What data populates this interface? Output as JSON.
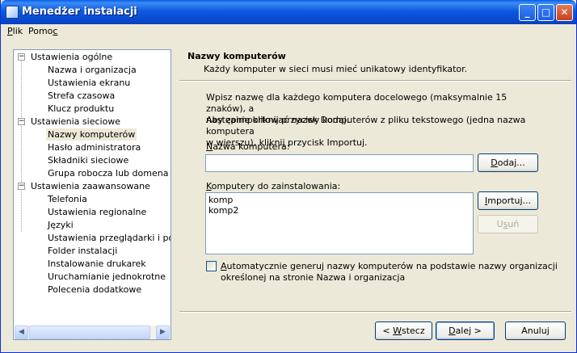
{
  "window": {
    "title": "Menedżer instalacji"
  },
  "menu": [
    {
      "label": "Plik",
      "key": "P",
      "rest": "lik"
    },
    {
      "label": "Pomoc",
      "pre": "Pomo",
      "key": "c"
    }
  ],
  "tree": {
    "groups": [
      {
        "label": "Ustawienia ogólne",
        "items": [
          "Nazwa i organizacja",
          "Ustawienia ekranu",
          "Strefa czasowa",
          "Klucz produktu"
        ]
      },
      {
        "label": "Ustawienia sieciowe",
        "items": [
          "Nazwy komputerów",
          "Hasło administratora",
          "Składniki sieciowe",
          "Grupa robocza lub domena"
        ]
      },
      {
        "label": "Ustawienia zaawansowane",
        "items": [
          "Telefonia",
          "Ustawienia regionalne",
          "Języki",
          "Ustawienia przeglądarki i powłok",
          "Folder instalacji",
          "Instalowanie drukarek",
          "Uruchamianie jednokrotne",
          "Polecenia dodatkowe"
        ]
      }
    ],
    "selected": "Nazwy komputerów",
    "toggle_glyph": "−"
  },
  "header": {
    "title": "Nazwy komputerów",
    "subtitle": "Każdy komputer w sieci musi mieć unikatowy identyfikator."
  },
  "body": {
    "para1_line1": "Wpisz nazwę dla każdego komputera docelowego (maksymalnie 15 znaków), a",
    "para1_line2": "następnie kliknij przycisk Dodaj.",
    "para2_line1": "Aby zaimportować nazwy komputerów z pliku tekstowego (jedna nazwa komputera",
    "para2_line2": "w wierszu), kliknij przycisk Importuj.",
    "name_label_key": "N",
    "name_label_rest": "azwa komputera:",
    "name_value": "",
    "list_label_key": "K",
    "list_label_rest": "omputery do zainstalowania:",
    "computers": [
      "komp",
      "komp2"
    ],
    "auto_label_key": "A",
    "auto_label_line1_rest": "utomatycznie generuj nazwy komputerów na podstawie nazwy organizacji",
    "auto_label_line2": "określonej na stronie Nazwa i organizacja",
    "auto_checked": false
  },
  "buttons": {
    "add": {
      "label": "Dodaj...",
      "key": "D",
      "rest": "odaj..."
    },
    "import": {
      "label": "Importuj...",
      "key": "I",
      "rest": "mportuj..."
    },
    "remove": {
      "label": "Usuń",
      "pre": "U",
      "key": "s",
      "rest": "uń"
    },
    "back": {
      "label": "< Wstecz",
      "pre": "< ",
      "key": "W",
      "rest": "stecz"
    },
    "next": {
      "label": "Dalej >",
      "key": "D",
      "rest": "alej >"
    },
    "cancel": {
      "label": "Anuluj"
    }
  },
  "window_controls": {
    "minimize": "_",
    "maximize": "□",
    "close": "✕"
  },
  "scroll_arrows": {
    "left": "◀",
    "right": "▶"
  },
  "colors": {
    "titlebar": "#0a5ee8",
    "selection": "#ece9d8",
    "close": "#e0542a"
  }
}
